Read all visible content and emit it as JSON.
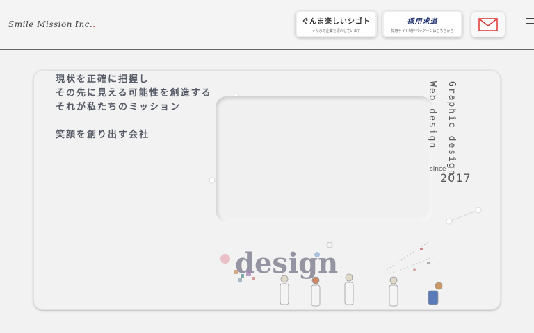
{
  "header": {
    "logo_text": "Smile Mission Inc.",
    "banner1": {
      "title": "ぐんま楽しいシゴト",
      "subtitle": "ぐんまの企業を紹介しています"
    },
    "banner2": {
      "title": "採用求道",
      "subtitle": "採用サイト制作パッケージはこちらから"
    }
  },
  "hero": {
    "copy_lines": [
      "現状を正確に把握し",
      "その先に見える可能性を創造する",
      "それが私たちのミッション"
    ],
    "tagline": "笑顔を創り出す会社",
    "vertical_1": "Graphic design",
    "vertical_2": "Web design",
    "since": "since",
    "year": "2017",
    "art_word": "design"
  },
  "colors": {
    "accent": "#d33333",
    "text": "#555a66",
    "background": "#f2f2f2"
  },
  "icons": [
    "mail-icon",
    "menu-icon"
  ]
}
